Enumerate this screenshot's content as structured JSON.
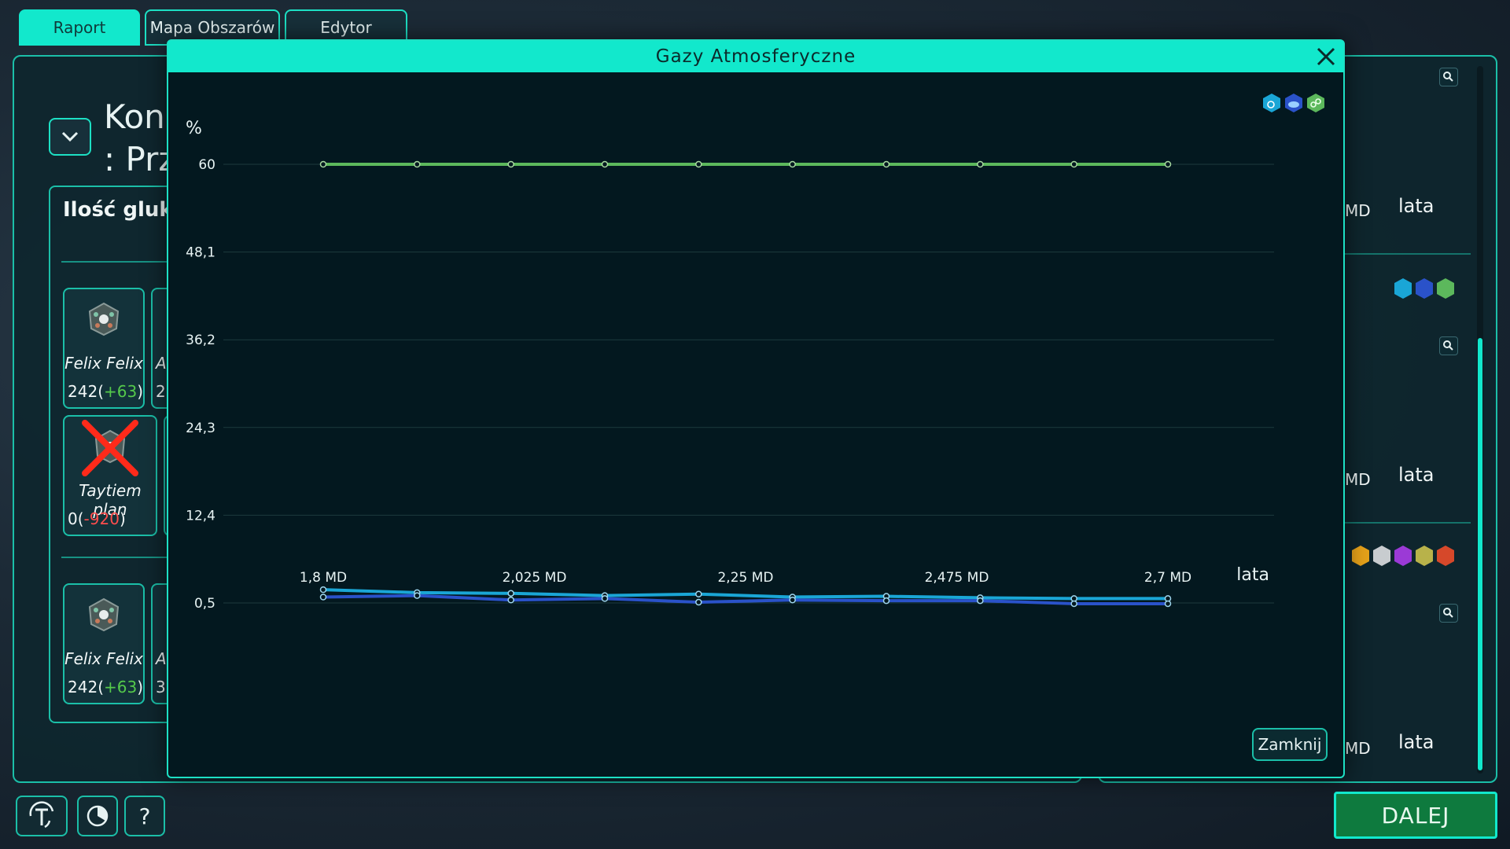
{
  "tabs": [
    {
      "label": "Raport",
      "active": true
    },
    {
      "label": "Mapa Obszarów",
      "active": false
    },
    {
      "label": "Edytor",
      "active": false
    }
  ],
  "background": {
    "title_line1": "Kons",
    "title_line2": ": Prz",
    "inner_title": "Ilość glukoz",
    "cards": [
      {
        "name": "Felix Felix",
        "value": "242",
        "delta": "+63"
      },
      {
        "name": "Taytiem plan",
        "value": "0",
        "delta": "-920"
      },
      {
        "name": "Felix Felix",
        "value": "242",
        "delta": "+63"
      }
    ],
    "sliver_texts": [
      "A",
      "2",
      "A",
      "3"
    ]
  },
  "right_panel": {
    "unit_label": "lata",
    "md_fragment": "MD"
  },
  "modal": {
    "title": "Gazy Atmosferyczne",
    "close_button": "Zamknij"
  },
  "chart_data": {
    "type": "line",
    "title": "Gazy Atmosferyczne",
    "xlabel": "lata",
    "ylabel": "%",
    "x": [
      1.8,
      1.9,
      2.0,
      2.1,
      2.2,
      2.3,
      2.4,
      2.5,
      2.6,
      2.7
    ],
    "x_tick_labels": [
      "1,8 MD",
      "2,025 MD",
      "2,25 MD",
      "2,475 MD",
      "2,7 MD"
    ],
    "x_tick_values": [
      1.8,
      2.025,
      2.25,
      2.475,
      2.7
    ],
    "y_tick_labels": [
      "0,5",
      "12,4",
      "24,3",
      "36,2",
      "48,1",
      "60"
    ],
    "y_tick_values": [
      0.5,
      12.4,
      24.3,
      36.2,
      48.1,
      60
    ],
    "xlim": [
      1.8,
      2.7
    ],
    "ylim": [
      0.5,
      60
    ],
    "grid": true,
    "series": [
      {
        "color": "#5cb85c",
        "values": [
          60,
          60,
          60,
          60,
          60,
          60,
          60,
          60,
          60,
          60
        ]
      },
      {
        "color": "#1aa6d6",
        "values": [
          2.3,
          1.9,
          1.8,
          1.5,
          1.7,
          1.3,
          1.4,
          1.2,
          1.1,
          1.1
        ]
      },
      {
        "color": "#2a52c9",
        "values": [
          1.3,
          1.5,
          0.9,
          1.1,
          0.6,
          0.9,
          0.8,
          0.8,
          0.4,
          0.4
        ]
      }
    ]
  },
  "legend_icons": [
    "water-drop-icon",
    "cloud-icon",
    "chain-link-icon"
  ],
  "toolbar": {
    "help_label": "?",
    "next_label": "DALEJ"
  },
  "colors": {
    "accent": "#12e8cc",
    "next_button": "#0e7a3e",
    "positive": "#55c94b",
    "negative": "#ff4d4d"
  }
}
